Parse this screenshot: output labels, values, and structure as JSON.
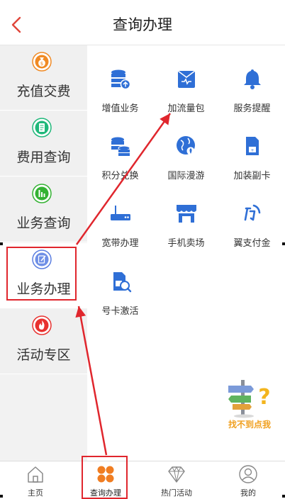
{
  "header": {
    "title": "查询办理"
  },
  "sidebar": {
    "items": [
      {
        "label": "充值交费",
        "icon": "money-bag-icon",
        "color": "#f08a24"
      },
      {
        "label": "费用查询",
        "icon": "bill-icon",
        "color": "#1fb87a"
      },
      {
        "label": "业务查询",
        "icon": "bar-chart-icon",
        "color": "#34b233"
      },
      {
        "label": "业务办理",
        "icon": "edit-icon",
        "color": "#5a7de0"
      },
      {
        "label": "活动专区",
        "icon": "fire-icon",
        "color": "#e8312f"
      }
    ],
    "active_index": 3
  },
  "grid": {
    "items": [
      {
        "label": "增值业务",
        "icon": "database-upload-icon"
      },
      {
        "label": "加流量包",
        "icon": "data-pack-icon"
      },
      {
        "label": "服务提醒",
        "icon": "bell-icon"
      },
      {
        "label": "积分兑换",
        "icon": "coins-icon"
      },
      {
        "label": "国际漫游",
        "icon": "globe-icon"
      },
      {
        "label": "加装副卡",
        "icon": "sim-card-icon"
      },
      {
        "label": "宽带办理",
        "icon": "router-icon"
      },
      {
        "label": "手机卖场",
        "icon": "store-icon"
      },
      {
        "label": "翼支付金",
        "icon": "wing-pay-icon"
      },
      {
        "label": "号卡激活",
        "icon": "sim-activate-icon"
      }
    ],
    "icon_color": "#2f6fd6"
  },
  "help": {
    "label": "找不到点我"
  },
  "tabbar": {
    "items": [
      {
        "label": "主页",
        "icon": "home-icon"
      },
      {
        "label": "查询办理",
        "icon": "grid-dots-icon",
        "color": "#f07d22"
      },
      {
        "label": "热门活动",
        "icon": "diamond-icon"
      },
      {
        "label": "我的",
        "icon": "user-icon"
      }
    ],
    "active_index": 1
  },
  "annotation_color": "#e0262d"
}
